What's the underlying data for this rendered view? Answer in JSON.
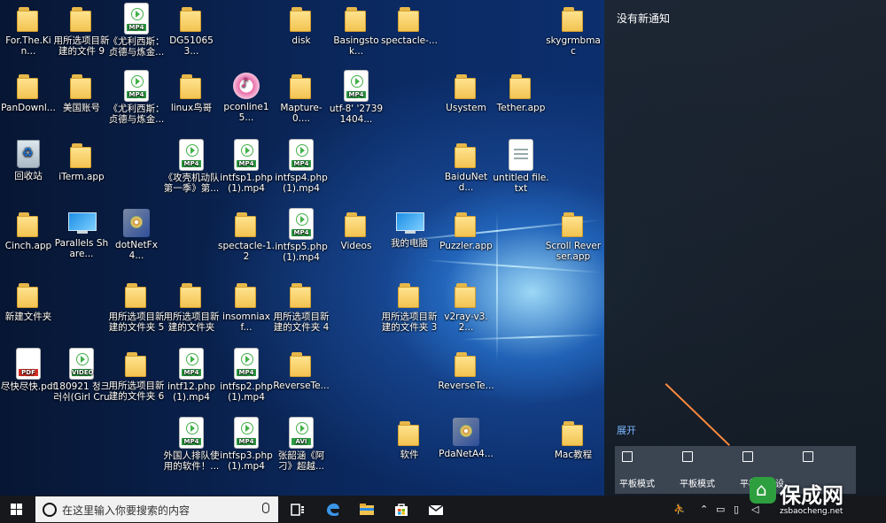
{
  "desktop": {
    "icons": [
      {
        "label": "For.The.Kin...",
        "kind": "folder",
        "col": 0,
        "row": 0
      },
      {
        "label": "用所选项目新建的文件 9",
        "kind": "folder",
        "col": 1,
        "row": 0
      },
      {
        "label": "《尤利西斯：贞德与炼金...",
        "kind": "mp4",
        "col": 2,
        "row": 0
      },
      {
        "label": "DG510653...",
        "kind": "folder",
        "col": 3,
        "row": 0
      },
      {
        "label": "disk",
        "kind": "folder",
        "col": 5,
        "row": 0
      },
      {
        "label": "Basingstok...",
        "kind": "folder",
        "col": 6,
        "row": 0
      },
      {
        "label": "spectacle-...",
        "kind": "folder",
        "col": 7,
        "row": 0
      },
      {
        "label": "skygrmbmac",
        "kind": "folder",
        "col": 10,
        "row": 0
      },
      {
        "label": "PanDownl...",
        "kind": "folder",
        "col": 0,
        "row": 1
      },
      {
        "label": "美国账号",
        "kind": "folder",
        "col": 1,
        "row": 1
      },
      {
        "label": "《尤利西斯：贞德与炼金...",
        "kind": "mp4",
        "col": 2,
        "row": 1
      },
      {
        "label": "linux鸟哥",
        "kind": "folder",
        "col": 3,
        "row": 1
      },
      {
        "label": "pconline15...",
        "kind": "itunes",
        "col": 4,
        "row": 1
      },
      {
        "label": "Mapture-0....",
        "kind": "folder",
        "col": 5,
        "row": 1
      },
      {
        "label": "utf-8' '27391404...",
        "kind": "mp4",
        "col": 6,
        "row": 1
      },
      {
        "label": "Usystem",
        "kind": "folder",
        "col": 8,
        "row": 1
      },
      {
        "label": "Tether.app",
        "kind": "folder",
        "col": 9,
        "row": 1
      },
      {
        "label": "回收站",
        "kind": "recycle",
        "col": 0,
        "row": 2
      },
      {
        "label": "iTerm.app",
        "kind": "folder",
        "col": 1,
        "row": 2
      },
      {
        "label": "《攻壳机动队第一季》第...",
        "kind": "mp4",
        "col": 3,
        "row": 2
      },
      {
        "label": "intfsp1.php (1).mp4",
        "kind": "mp4",
        "col": 4,
        "row": 2
      },
      {
        "label": "intfsp4.php (1).mp4",
        "kind": "mp4",
        "col": 5,
        "row": 2
      },
      {
        "label": "BaiduNetd...",
        "kind": "folder",
        "col": 8,
        "row": 2
      },
      {
        "label": "untitled file.txt",
        "kind": "txt",
        "col": 9,
        "row": 2
      },
      {
        "label": "Cinch.app",
        "kind": "folder",
        "col": 0,
        "row": 3
      },
      {
        "label": "Parallels Share...",
        "kind": "pc",
        "col": 1,
        "row": 3
      },
      {
        "label": "dotNetFx4...",
        "kind": "setup",
        "col": 2,
        "row": 3
      },
      {
        "label": "spectacle-1.2",
        "kind": "folder",
        "col": 4,
        "row": 3
      },
      {
        "label": "intfsp5.php (1).mp4",
        "kind": "mp4",
        "col": 5,
        "row": 3
      },
      {
        "label": "Videos",
        "kind": "folder",
        "col": 6,
        "row": 3
      },
      {
        "label": "我的电脑",
        "kind": "pc",
        "col": 7,
        "row": 3
      },
      {
        "label": "Puzzler.app",
        "kind": "folder",
        "col": 8,
        "row": 3
      },
      {
        "label": "Scroll Reverser.app",
        "kind": "folder",
        "col": 10,
        "row": 3
      },
      {
        "label": "新建文件夹",
        "kind": "folder",
        "col": 0,
        "row": 4
      },
      {
        "label": "用所选项目新建的文件夹 5",
        "kind": "folder",
        "col": 2,
        "row": 4
      },
      {
        "label": "用所选项目新建的文件夹",
        "kind": "folder",
        "col": 3,
        "row": 4
      },
      {
        "label": "insomniaxf...",
        "kind": "folder",
        "col": 4,
        "row": 4
      },
      {
        "label": "用所选项目新建的文件夹 4",
        "kind": "folder",
        "col": 5,
        "row": 4
      },
      {
        "label": "用所选项目新建的文件夹 3",
        "kind": "folder",
        "col": 7,
        "row": 4
      },
      {
        "label": "v2ray-v3.2...",
        "kind": "folder",
        "col": 8,
        "row": 4
      },
      {
        "label": "尽快尽快.pdf",
        "kind": "pdf",
        "col": 0,
        "row": 5
      },
      {
        "label": "180921 청크러쉬(Girl Crus...",
        "kind": "video",
        "col": 1,
        "row": 5
      },
      {
        "label": "用所选项目新建的文件夹 6",
        "kind": "folder",
        "col": 2,
        "row": 5
      },
      {
        "label": "intf12.php (1).mp4",
        "kind": "mp4",
        "col": 3,
        "row": 5
      },
      {
        "label": "intfsp2.php (1).mp4",
        "kind": "mp4",
        "col": 4,
        "row": 5
      },
      {
        "label": "ReverseTe...",
        "kind": "folder",
        "col": 5,
        "row": 5
      },
      {
        "label": "ReverseTe...",
        "kind": "folder",
        "col": 8,
        "row": 5
      },
      {
        "label": "外国人排队使用的软件！...",
        "kind": "mp4",
        "col": 3,
        "row": 6
      },
      {
        "label": "intfsp3.php (1).mp4",
        "kind": "mp4",
        "col": 4,
        "row": 6
      },
      {
        "label": "张韶涵《阿刁》超越...",
        "kind": "avi",
        "col": 5,
        "row": 6
      },
      {
        "label": "软件",
        "kind": "folder",
        "col": 7,
        "row": 6
      },
      {
        "label": "PdaNetA4...",
        "kind": "setup",
        "col": 8,
        "row": 6
      },
      {
        "label": "Mac教程",
        "kind": "folder",
        "col": 10,
        "row": 6
      }
    ],
    "badges": {
      "mp4": "MP4",
      "pdf": "PDF",
      "video": "VIDEO",
      "avi": "AVI"
    }
  },
  "action_center": {
    "title": "没有新通知",
    "expand": "展开",
    "tiles": [
      {
        "label": "平板模式",
        "icon": "tablet-icon"
      },
      {
        "label": "平板模式",
        "icon": "tablet-icon"
      },
      {
        "label": "平板所有设",
        "icon": "tablet-icon"
      },
      {
        "label": "",
        "icon": "tablet-icon"
      }
    ]
  },
  "taskbar": {
    "search_placeholder": "在这里输入你要搜索的内容",
    "icons": [
      "task-view-icon",
      "edge-icon",
      "file-explorer-icon",
      "store-icon",
      "mail-icon"
    ]
  },
  "watermark": {
    "text": "保成网",
    "sub": "zsbaocheng.net"
  },
  "colors": {
    "accent": "#2e9f3f",
    "action_bg": "#1e2630",
    "taskbar": "#16181c",
    "link": "#7db7ff"
  }
}
